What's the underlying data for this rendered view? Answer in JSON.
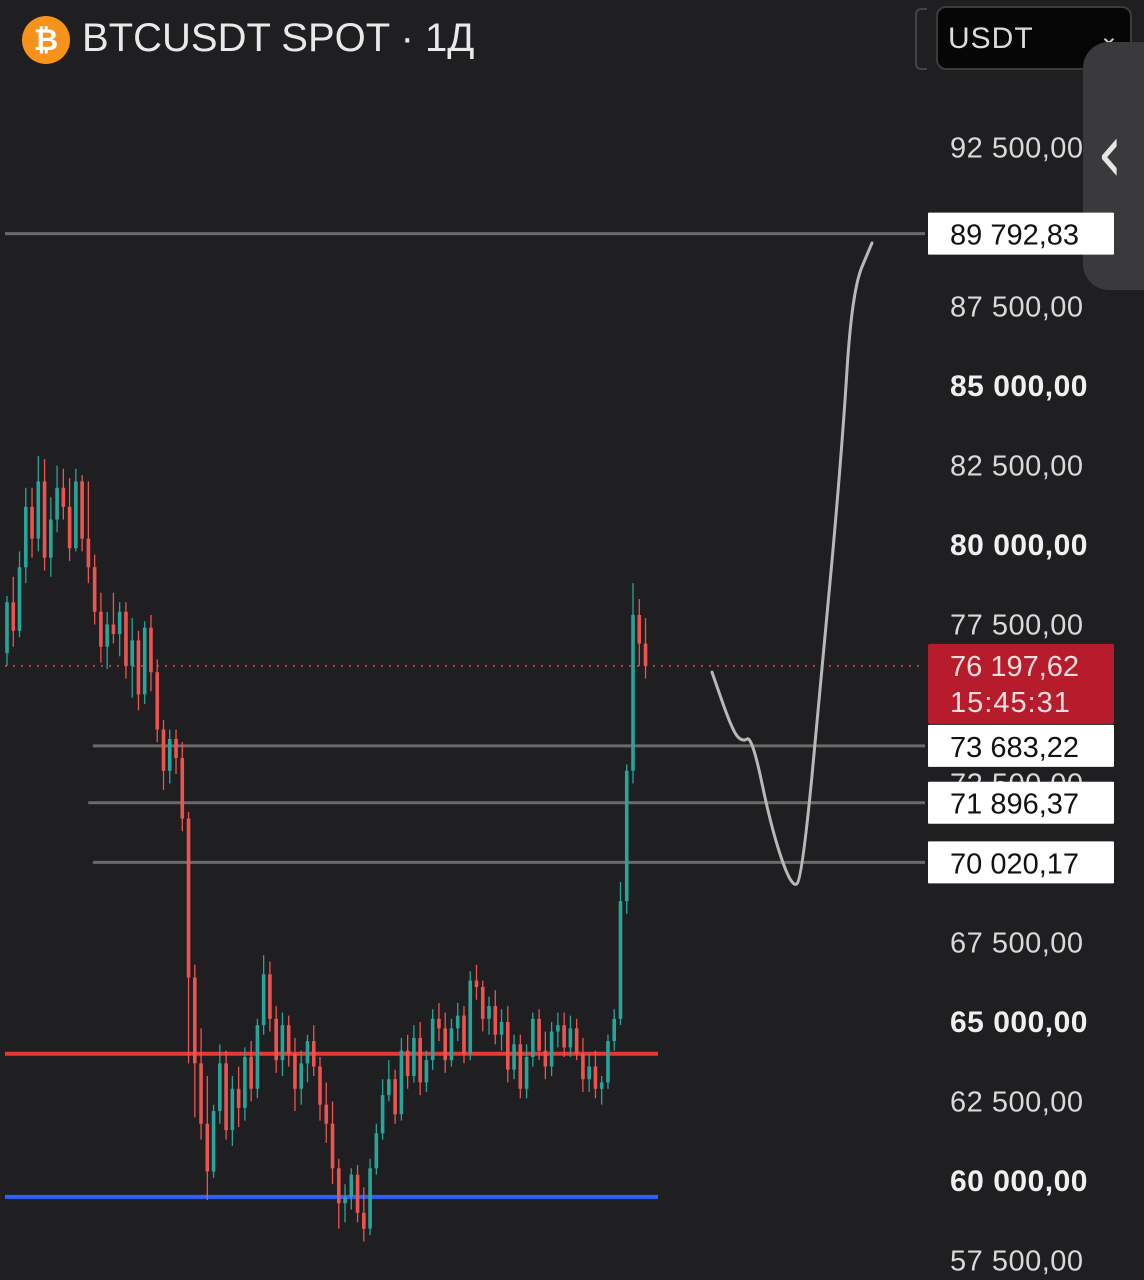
{
  "header": {
    "title": "BTCUSDT SPOT · 1Д",
    "currency": "USDT",
    "icon": "bitcoin-icon"
  },
  "colors": {
    "background": "#1f1f21",
    "bull": "#26a69a",
    "bear": "#ef5350",
    "support_red": "#e53935",
    "support_blue": "#2962ff",
    "current_price_bg": "#b71c2c",
    "level_line": "#6a6a6a"
  },
  "chart_data": {
    "type": "candlestick",
    "symbol": "BTCUSDT",
    "exchange_type": "SPOT",
    "timeframe": "1Д",
    "ylim": [
      56500,
      94500
    ],
    "y_ticks": [
      {
        "value": 92500,
        "label": "92 500,00",
        "bold": false
      },
      {
        "value": 87500,
        "label": "87 500,00",
        "bold": false
      },
      {
        "value": 85000,
        "label": "85 000,00",
        "bold": true
      },
      {
        "value": 82500,
        "label": "82 500,00",
        "bold": false
      },
      {
        "value": 80000,
        "label": "80 000,00",
        "bold": true
      },
      {
        "value": 77500,
        "label": "77 500,00",
        "bold": false
      },
      {
        "value": 72500,
        "label": "72 500,00",
        "bold": false
      },
      {
        "value": 67500,
        "label": "67 500,00",
        "bold": false
      },
      {
        "value": 65000,
        "label": "65 000,00",
        "bold": true
      },
      {
        "value": 62500,
        "label": "62 500,00",
        "bold": false
      },
      {
        "value": 60000,
        "label": "60 000,00",
        "bold": true
      },
      {
        "value": 57500,
        "label": "57 500,00",
        "bold": false
      }
    ],
    "current_price": {
      "value": 76197.62,
      "label": "76 197,62",
      "countdown": "15:45:31"
    },
    "levels": [
      {
        "value": 89792.83,
        "label": "89 792,83",
        "color": "#6a6a6a",
        "x_start": 0.0
      },
      {
        "value": 73683.22,
        "label": "73 683,22",
        "color": "#6a6a6a",
        "x_start": 0.095
      },
      {
        "value": 71896.37,
        "label": "71 896,37",
        "color": "#6a6a6a",
        "x_start": 0.09
      },
      {
        "value": 70020.17,
        "label": "70 020,17",
        "color": "#6a6a6a",
        "x_start": 0.095
      }
    ],
    "support_lines": [
      {
        "value": 64000,
        "color": "#e53935"
      },
      {
        "value": 59500,
        "color": "#2962ff"
      }
    ],
    "projection_path": [
      [
        0,
        76000
      ],
      [
        2,
        74200
      ],
      [
        3,
        73800
      ],
      [
        4,
        74000
      ],
      [
        6,
        71000
      ],
      [
        8,
        69200
      ],
      [
        9,
        69500
      ],
      [
        11,
        76000
      ],
      [
        13,
        83000
      ],
      [
        14,
        88000
      ],
      [
        16,
        89500
      ]
    ],
    "candles": [
      [
        76600,
        78400,
        76200,
        78200
      ],
      [
        78200,
        79000,
        76800,
        77300
      ],
      [
        77300,
        79800,
        77100,
        79300
      ],
      [
        79300,
        81800,
        78800,
        81200
      ],
      [
        81200,
        81800,
        79600,
        80200
      ],
      [
        80200,
        82800,
        79800,
        82000
      ],
      [
        82000,
        82700,
        79200,
        79600
      ],
      [
        79600,
        81500,
        79000,
        80800
      ],
      [
        80800,
        82500,
        80400,
        81800
      ],
      [
        81800,
        82400,
        80800,
        81200
      ],
      [
        81200,
        82100,
        79500,
        79900
      ],
      [
        79900,
        82400,
        79800,
        82000
      ],
      [
        82000,
        82200,
        79800,
        80200
      ],
      [
        80200,
        82000,
        78800,
        79300
      ],
      [
        79300,
        79700,
        77500,
        77900
      ],
      [
        77900,
        78500,
        76300,
        76800
      ],
      [
        76800,
        77900,
        76100,
        77500
      ],
      [
        77500,
        78500,
        76900,
        77200
      ],
      [
        77200,
        78200,
        76500,
        77900
      ],
      [
        77900,
        78200,
        75800,
        76200
      ],
      [
        76200,
        77700,
        75200,
        77000
      ],
      [
        77000,
        77300,
        74800,
        75300
      ],
      [
        75300,
        77600,
        75000,
        77400
      ],
      [
        77400,
        77800,
        75400,
        76000
      ],
      [
        76000,
        76400,
        73800,
        74200
      ],
      [
        74200,
        74500,
        72300,
        72900
      ],
      [
        72900,
        74200,
        72500,
        73900
      ],
      [
        73900,
        74200,
        72800,
        73300
      ],
      [
        73300,
        73800,
        71000,
        71400
      ],
      [
        71400,
        71600,
        63700,
        66400
      ],
      [
        66400,
        66800,
        62000,
        63700
      ],
      [
        63700,
        64800,
        61300,
        61800
      ],
      [
        61800,
        63300,
        59400,
        60300
      ],
      [
        60300,
        62400,
        60100,
        62200
      ],
      [
        62200,
        64300,
        61800,
        63700
      ],
      [
        63700,
        64100,
        61300,
        61600
      ],
      [
        61600,
        63300,
        61100,
        62900
      ],
      [
        62900,
        63600,
        61700,
        62300
      ],
      [
        62300,
        64200,
        61900,
        63900
      ],
      [
        63900,
        64400,
        62500,
        62900
      ],
      [
        62900,
        65100,
        62600,
        64900
      ],
      [
        64900,
        67100,
        64600,
        66500
      ],
      [
        66500,
        66900,
        64700,
        65100
      ],
      [
        65100,
        65500,
        63400,
        63800
      ],
      [
        63800,
        65300,
        63300,
        64900
      ],
      [
        64900,
        65200,
        63600,
        64000
      ],
      [
        64000,
        64500,
        62200,
        62900
      ],
      [
        62900,
        64100,
        62400,
        63700
      ],
      [
        63700,
        64600,
        63100,
        64400
      ],
      [
        64400,
        64900,
        63300,
        63600
      ],
      [
        63600,
        63900,
        61900,
        62400
      ],
      [
        62400,
        63100,
        61200,
        61800
      ],
      [
        61800,
        62500,
        59900,
        60400
      ],
      [
        60400,
        60700,
        58500,
        59300
      ],
      [
        59300,
        59900,
        58700,
        59500
      ],
      [
        59500,
        60400,
        59100,
        60200
      ],
      [
        60200,
        60500,
        58700,
        59000
      ],
      [
        59000,
        59800,
        58100,
        58500
      ],
      [
        58500,
        60700,
        58300,
        60400
      ],
      [
        60400,
        61800,
        60200,
        61500
      ],
      [
        61500,
        63200,
        61300,
        62700
      ],
      [
        62700,
        63800,
        62500,
        63200
      ],
      [
        63200,
        63500,
        61800,
        62100
      ],
      [
        62100,
        64500,
        61900,
        64100
      ],
      [
        64100,
        64600,
        62900,
        63300
      ],
      [
        63300,
        64900,
        63100,
        64500
      ],
      [
        64500,
        65000,
        62700,
        63100
      ],
      [
        63100,
        64100,
        62800,
        63800
      ],
      [
        63800,
        65400,
        63500,
        65100
      ],
      [
        65100,
        65600,
        64400,
        64800
      ],
      [
        64800,
        65300,
        63400,
        63800
      ],
      [
        63800,
        65100,
        63600,
        64800
      ],
      [
        64800,
        65600,
        64400,
        65200
      ],
      [
        65200,
        65500,
        63700,
        64000
      ],
      [
        64000,
        66600,
        63800,
        66300
      ],
      [
        66300,
        66800,
        65700,
        66100
      ],
      [
        66100,
        66300,
        64700,
        65100
      ],
      [
        65100,
        65800,
        64600,
        65500
      ],
      [
        65500,
        66000,
        64300,
        64600
      ],
      [
        64600,
        65400,
        64100,
        65000
      ],
      [
        65000,
        65500,
        63100,
        63500
      ],
      [
        63500,
        64600,
        63200,
        64300
      ],
      [
        64300,
        64600,
        62600,
        62900
      ],
      [
        62900,
        64300,
        62600,
        63900
      ],
      [
        63900,
        65300,
        63600,
        65100
      ],
      [
        65100,
        65400,
        63800,
        64100
      ],
      [
        64100,
        64700,
        63200,
        63600
      ],
      [
        63600,
        65000,
        63300,
        64700
      ],
      [
        64700,
        65300,
        64200,
        64900
      ],
      [
        64900,
        65300,
        63900,
        64200
      ],
      [
        64200,
        65200,
        63900,
        64800
      ],
      [
        64800,
        65100,
        63800,
        64000
      ],
      [
        64000,
        64500,
        62800,
        63200
      ],
      [
        63200,
        64000,
        62800,
        63600
      ],
      [
        63600,
        64100,
        62600,
        62900
      ],
      [
        62900,
        63300,
        62400,
        63100
      ],
      [
        63100,
        64600,
        62900,
        64400
      ],
      [
        64400,
        65400,
        64100,
        65100
      ],
      [
        65100,
        69400,
        64900,
        68800
      ],
      [
        68800,
        73100,
        68400,
        72900
      ],
      [
        72900,
        78800,
        72500,
        77800
      ],
      [
        77800,
        78300,
        76200,
        76900
      ],
      [
        76900,
        77700,
        75800,
        76197.62
      ]
    ]
  }
}
